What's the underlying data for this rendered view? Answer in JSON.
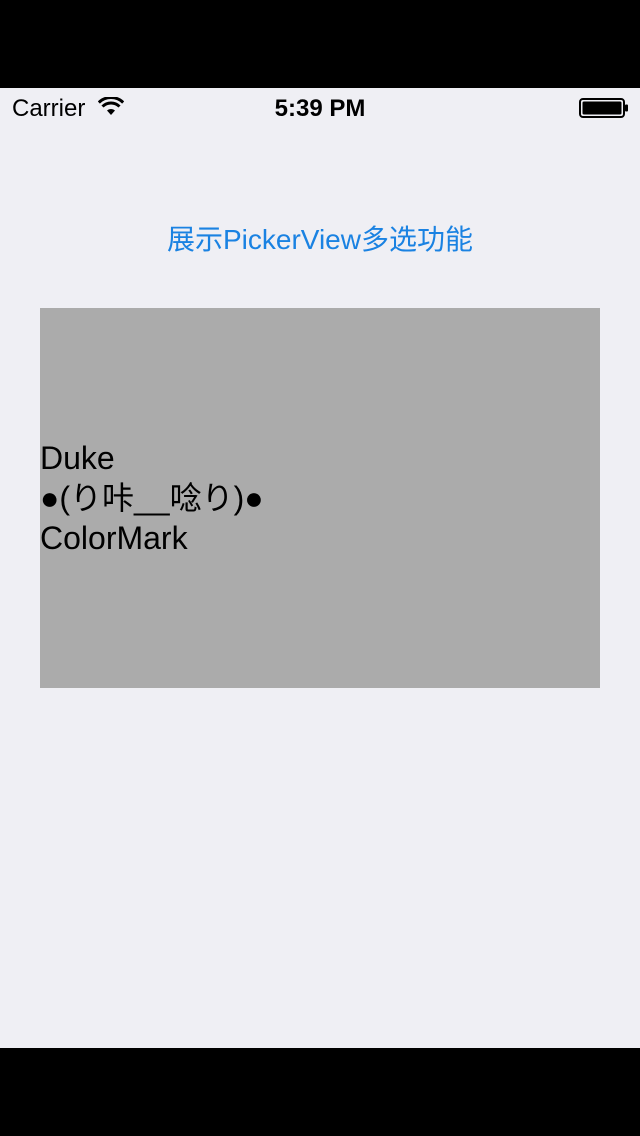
{
  "status_bar": {
    "carrier": "Carrier",
    "time": "5:39 PM",
    "wifi_icon": "wifi-icon",
    "battery_icon": "battery-full-icon"
  },
  "main": {
    "action_button_label": "展示PickerView多选功能",
    "picker_lines": [
      "Duke",
      "●(り咔__唸り)●",
      "ColorMark"
    ]
  },
  "colors": {
    "background": "#efeff4",
    "accent": "#1a82e2",
    "picker_background": "#ababab"
  }
}
